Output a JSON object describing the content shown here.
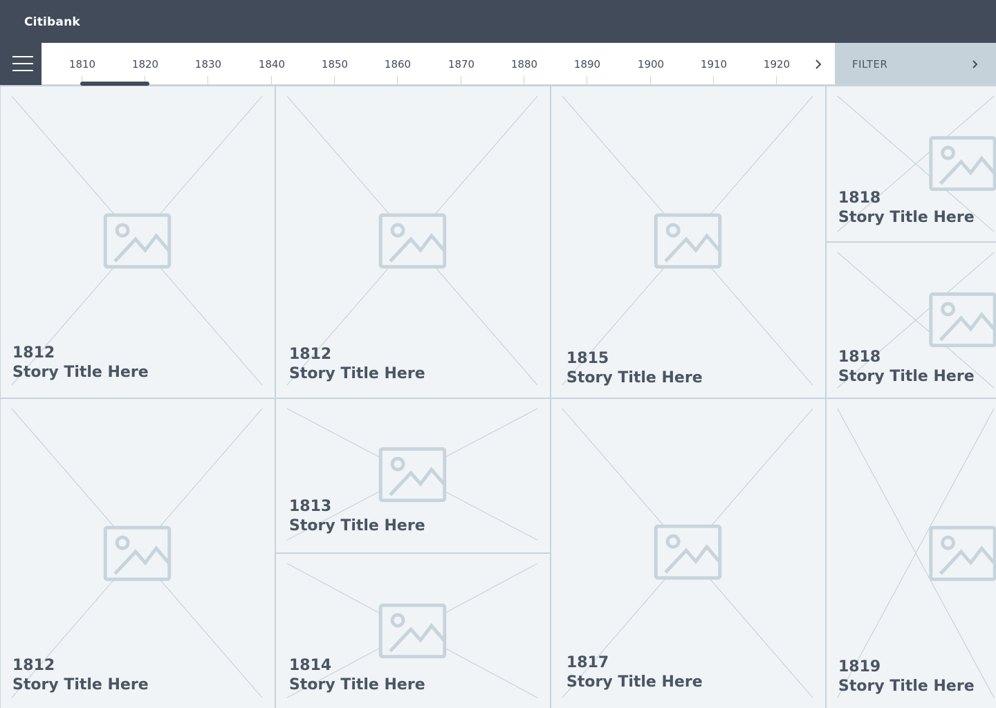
{
  "header": {
    "brand": "Citibank"
  },
  "timeline": {
    "decades": [
      "1810",
      "1820",
      "1830",
      "1840",
      "1850",
      "1860",
      "1870",
      "1880",
      "1890",
      "1900",
      "1910",
      "1920"
    ],
    "selected": "1810"
  },
  "filter": {
    "label": "FILTER"
  },
  "stories": [
    {
      "year": "1812",
      "title": "Story Title Here"
    },
    {
      "year": "1812",
      "title": "Story Title Here"
    },
    {
      "year": "1815",
      "title": "Story Title Here"
    },
    {
      "year": "1818",
      "title": "Story Title Here"
    },
    {
      "year": "1818",
      "title": "Story Title Here"
    },
    {
      "year": "1812",
      "title": "Story Title Here"
    },
    {
      "year": "1813",
      "title": "Story Title Here"
    },
    {
      "year": "1814",
      "title": "Story Title Here"
    },
    {
      "year": "1817",
      "title": "Story Title Here"
    },
    {
      "year": "1819",
      "title": "Story Title Here"
    }
  ],
  "colors": {
    "header": "#414b5a",
    "tile": "#f0f4f7",
    "placeholder": "#c8d4dc",
    "text": "#4b5563",
    "filter": "#c6d2da"
  },
  "icons": {
    "menu": "hamburger-icon",
    "next": "chevron-right-icon",
    "image": "image-placeholder-icon"
  }
}
